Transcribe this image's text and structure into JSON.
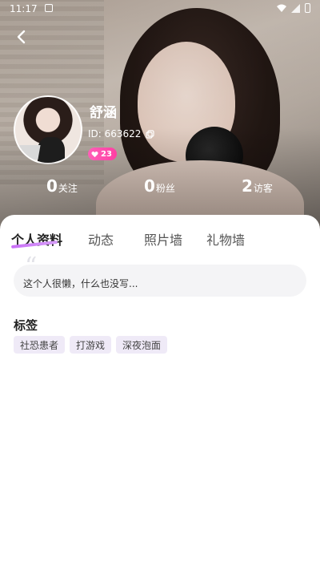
{
  "status_bar": {
    "time": "11:17"
  },
  "profile": {
    "nickname": "舒涵",
    "id_text": "ID: 663622",
    "level": "23"
  },
  "stats": [
    {
      "value": "0",
      "label": "关注"
    },
    {
      "value": "0",
      "label": "粉丝"
    },
    {
      "value": "2",
      "label": "访客"
    }
  ],
  "tabs": [
    {
      "label": "个人资料",
      "active": true
    },
    {
      "label": "动态",
      "active": false
    },
    {
      "label": "照片墙",
      "active": false
    },
    {
      "label": "礼物墙",
      "active": false
    }
  ],
  "bio": {
    "quote": "“",
    "text": "这个人很懒，什么也没写..."
  },
  "tags": {
    "title": "标签",
    "items": [
      "社恐患者",
      "打游戏",
      "深夜泡面"
    ]
  },
  "colors": {
    "accent": "#c96ff7",
    "badge": "#ff4fa9",
    "tag_bg": "#efeaf7"
  }
}
